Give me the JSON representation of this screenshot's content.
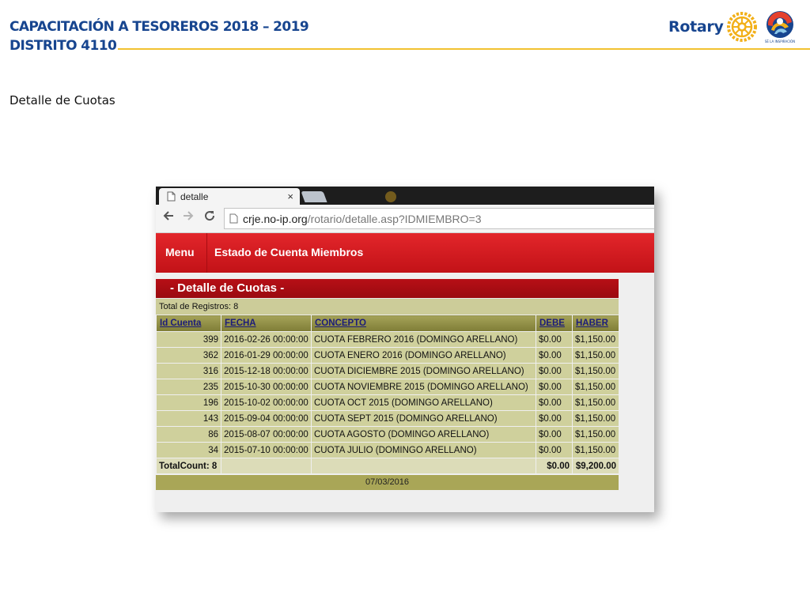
{
  "slide": {
    "title_line1": "CAPACITACIÓN A TESOREROS 2018 – 2019",
    "title_line2": "DISTRITO 4110",
    "subtitle": "Detalle de Cuotas",
    "brand": "Rotary",
    "theme_caption": "SÉ LA INSPIRACIÓN",
    "colors": {
      "title": "#17458f",
      "rule": "#f2c230"
    }
  },
  "browser": {
    "tab_title": "detalle",
    "tab_close": "×",
    "url_host": "crje.no-ip.org",
    "url_path": "/rotario/detalle.asp?IDMIEMBRO=3",
    "icons": {
      "back": "arrow-left-icon",
      "forward": "arrow-right-icon",
      "reload": "reload-icon"
    }
  },
  "app": {
    "menu_label": "Menu",
    "menu_section": "Estado de Cuenta Miembros",
    "detail_title": "- Detalle de Cuotas -",
    "total_records": "Total de Registros: 8",
    "columns": [
      "Id Cuenta",
      "FECHA",
      "CONCEPTO",
      "DEBE",
      "HABER"
    ],
    "rows": [
      {
        "id": "399",
        "fecha": "2016-02-26 00:00:00",
        "concepto": "CUOTA FEBRERO 2016 (DOMINGO ARELLANO)",
        "debe": "$0.00",
        "haber": "$1,150.00"
      },
      {
        "id": "362",
        "fecha": "2016-01-29 00:00:00",
        "concepto": "CUOTA ENERO 2016 (DOMINGO ARELLANO)",
        "debe": "$0.00",
        "haber": "$1,150.00"
      },
      {
        "id": "316",
        "fecha": "2015-12-18 00:00:00",
        "concepto": "CUOTA DICIEMBRE 2015 (DOMINGO ARELLANO)",
        "debe": "$0.00",
        "haber": "$1,150.00"
      },
      {
        "id": "235",
        "fecha": "2015-10-30 00:00:00",
        "concepto": "CUOTA NOVIEMBRE 2015 (DOMINGO ARELLANO)",
        "debe": "$0.00",
        "haber": "$1,150.00"
      },
      {
        "id": "196",
        "fecha": "2015-10-02 00:00:00",
        "concepto": "CUOTA OCT 2015 (DOMINGO ARELLANO)",
        "debe": "$0.00",
        "haber": "$1,150.00"
      },
      {
        "id": "143",
        "fecha": "2015-09-04 00:00:00",
        "concepto": "CUOTA SEPT 2015 (DOMINGO ARELLANO)",
        "debe": "$0.00",
        "haber": "$1,150.00"
      },
      {
        "id": "86",
        "fecha": "2015-08-07 00:00:00",
        "concepto": "CUOTA AGOSTO (DOMINGO ARELLANO)",
        "debe": "$0.00",
        "haber": "$1,150.00"
      },
      {
        "id": "34",
        "fecha": "2015-07-10 00:00:00",
        "concepto": "CUOTA JULIO (DOMINGO ARELLANO)",
        "debe": "$0.00",
        "haber": "$1,150.00"
      }
    ],
    "footer": {
      "count": "TotalCount: 8",
      "debe_total": "$0.00",
      "haber_total": "$9,200.00"
    },
    "date": "07/03/2016",
    "colors": {
      "menu": "#d41a1f",
      "title_bar": "#a80c12",
      "row": "#cfd09c",
      "header": "#8f8d44"
    }
  }
}
